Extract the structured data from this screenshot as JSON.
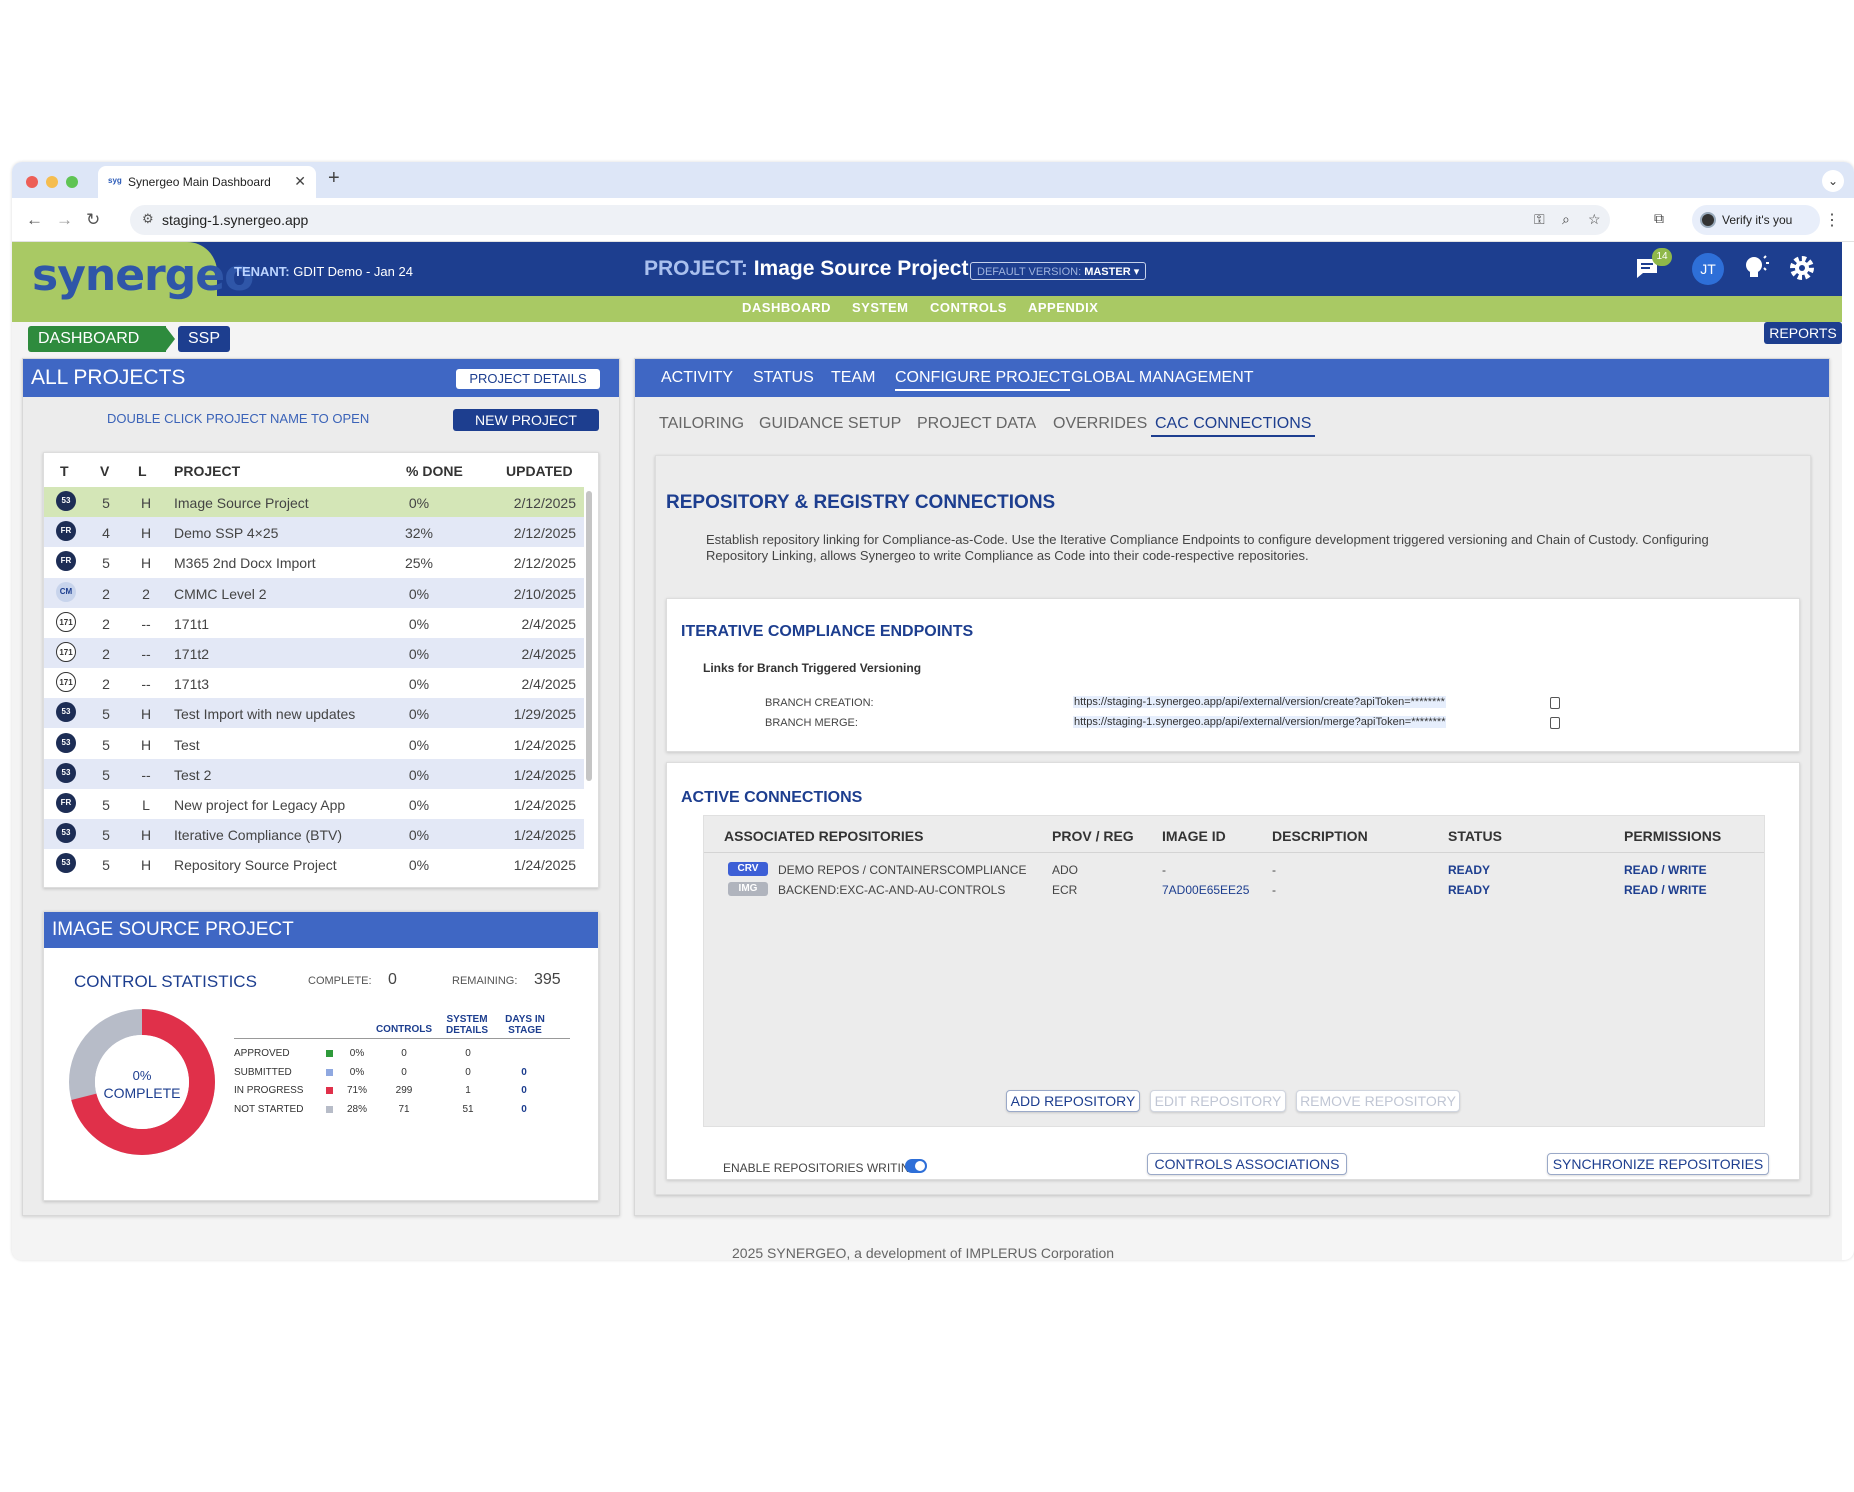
{
  "browser": {
    "tab_title": "Synergeo Main Dashboard",
    "tab_favicon_text": "syg",
    "url": "staging-1.synergeo.app",
    "verify_label": "Verify it's you"
  },
  "header": {
    "logo": "synergeo",
    "tenant_label": "TENANT:",
    "tenant_value": "GDIT Demo - Jan 24",
    "project_label": "PROJECT:",
    "project_name": "Image Source Project",
    "version_label": "DEFAULT VERSION:",
    "version_value": "MASTER",
    "notifications_count": "14",
    "user_initials": "JT"
  },
  "topnav": [
    "DASHBOARD",
    "SYSTEM",
    "CONTROLS",
    "APPENDIX"
  ],
  "breadcrumb": [
    "DASHBOARD",
    "SSP"
  ],
  "reports_label": "REPORTS",
  "left_panel": {
    "title": "ALL PROJECTS",
    "details_button": "PROJECT DETAILS",
    "hint": "DOUBLE CLICK PROJECT NAME TO OPEN",
    "new_button": "NEW PROJECT",
    "columns": [
      "T",
      "V",
      "L",
      "PROJECT",
      "% DONE",
      "UPDATED"
    ],
    "rows": [
      {
        "icon": "53",
        "v": "5",
        "l": "H",
        "name": "Image Source Project",
        "done": "0%",
        "updated": "2/12/2025"
      },
      {
        "icon": "FR",
        "v": "4",
        "l": "H",
        "name": "Demo SSP 4×25",
        "done": "32%",
        "updated": "2/12/2025"
      },
      {
        "icon": "FR",
        "v": "5",
        "l": "H",
        "name": "M365 2nd Docx Import",
        "done": "25%",
        "updated": "2/12/2025"
      },
      {
        "icon": "CM",
        "v": "2",
        "l": "2",
        "name": "CMMC Level 2",
        "done": "0%",
        "updated": "2/10/2025"
      },
      {
        "icon": "171",
        "v": "2",
        "l": "--",
        "name": "171t1",
        "done": "0%",
        "updated": "2/4/2025"
      },
      {
        "icon": "171",
        "v": "2",
        "l": "--",
        "name": "171t2",
        "done": "0%",
        "updated": "2/4/2025"
      },
      {
        "icon": "171",
        "v": "2",
        "l": "--",
        "name": "171t3",
        "done": "0%",
        "updated": "2/4/2025"
      },
      {
        "icon": "53",
        "v": "5",
        "l": "H",
        "name": "Test Import with new updates",
        "done": "0%",
        "updated": "1/29/2025"
      },
      {
        "icon": "53",
        "v": "5",
        "l": "H",
        "name": "Test",
        "done": "0%",
        "updated": "1/24/2025"
      },
      {
        "icon": "53",
        "v": "5",
        "l": "--",
        "name": "Test 2",
        "done": "0%",
        "updated": "1/24/2025"
      },
      {
        "icon": "FR",
        "v": "5",
        "l": "L",
        "name": "New project for Legacy App",
        "done": "0%",
        "updated": "1/24/2025"
      },
      {
        "icon": "53",
        "v": "5",
        "l": "H",
        "name": "Iterative Compliance (BTV)",
        "done": "0%",
        "updated": "1/24/2025"
      },
      {
        "icon": "53",
        "v": "5",
        "l": "H",
        "name": "Repository Source Project",
        "done": "0%",
        "updated": "1/24/2025"
      }
    ]
  },
  "stats": {
    "title": "IMAGE SOURCE PROJECT",
    "subtitle": "CONTROL STATISTICS",
    "complete_label": "COMPLETE:",
    "complete_value": "0",
    "remaining_label": "REMAINING:",
    "remaining_value": "395",
    "donut_percent": "0%",
    "donut_label": "COMPLETE",
    "col_controls": "CONTROLS",
    "col_system": "SYSTEM DETAILS",
    "col_days": "DAYS IN STAGE",
    "rows": [
      {
        "label": "APPROVED",
        "color": "#2e9a3a",
        "pct": "0%",
        "controls": "0",
        "system": "0",
        "days": ""
      },
      {
        "label": "SUBMITTED",
        "color": "#8fa8e0",
        "pct": "0%",
        "controls": "0",
        "system": "0",
        "days": "0"
      },
      {
        "label": "IN PROGRESS",
        "color": "#e0304a",
        "pct": "71%",
        "controls": "299",
        "system": "1",
        "days": "0"
      },
      {
        "label": "NOT STARTED",
        "color": "#b7bcc8",
        "pct": "28%",
        "controls": "71",
        "system": "51",
        "days": "0"
      }
    ],
    "donut_fractions": {
      "in_progress": 0.71,
      "not_started": 0.29
    }
  },
  "right_panel": {
    "tabs": [
      "ACTIVITY",
      "STATUS",
      "TEAM",
      "CONFIGURE PROJECT",
      "GLOBAL MANAGEMENT"
    ],
    "active_tab": "CONFIGURE PROJECT",
    "subtabs": [
      "TAILORING",
      "GUIDANCE SETUP",
      "PROJECT DATA",
      "OVERRIDES",
      "CAC CONNECTIONS"
    ],
    "active_subtab": "CAC CONNECTIONS",
    "section_title": "REPOSITORY & REGISTRY CONNECTIONS",
    "section_desc": "Establish repository linking for Compliance-as-Code. Use the Iterative Compliance Endpoints to configure development triggered versioning and Chain of Custody. Configuring Repository Linking, allows Synergeo to write Compliance as Code into their code-respective repositories.",
    "endpoints": {
      "title": "ITERATIVE COMPLIANCE ENDPOINTS",
      "subtitle": "Links for Branch Triggered Versioning",
      "branch_creation_label": "BRANCH CREATION:",
      "branch_creation_url": "https://staging-1.synergeo.app/api/external/version/create?apiToken=********",
      "branch_merge_label": "BRANCH MERGE:",
      "branch_merge_url": "https://staging-1.synergeo.app/api/external/version/merge?apiToken=********"
    },
    "connections": {
      "title": "ACTIVE CONNECTIONS",
      "columns": [
        "ASSOCIATED REPOSITORIES",
        "PROV / REG",
        "IMAGE ID",
        "DESCRIPTION",
        "STATUS",
        "PERMISSIONS"
      ],
      "rows": [
        {
          "tag": "CRV",
          "tag_color": "#3d5fd6",
          "repo": "DEMO REPOS / CONTAINERSCOMPLIANCE",
          "prov": "ADO",
          "image": "-",
          "desc": "-",
          "status": "READY",
          "perms": "READ / WRITE"
        },
        {
          "tag": "IMG",
          "tag_color": "#b0b4bd",
          "repo": "BACKEND:EXC-AC-AND-AU-CONTROLS",
          "prov": "ECR",
          "image": "7AD00E65EE25",
          "desc": "-",
          "status": "READY",
          "perms": "READ / WRITE"
        }
      ],
      "add_button": "ADD REPOSITORY",
      "edit_button": "EDIT REPOSITORY",
      "remove_button": "REMOVE REPOSITORY",
      "enable_label": "ENABLE REPOSITORIES WRITING",
      "enable_on": true,
      "controls_button": "CONTROLS ASSOCIATIONS",
      "sync_button": "SYNCHRONIZE REPOSITORIES"
    }
  },
  "footer": "2025 SYNERGEO, a development of IMPLERUS Corporation"
}
